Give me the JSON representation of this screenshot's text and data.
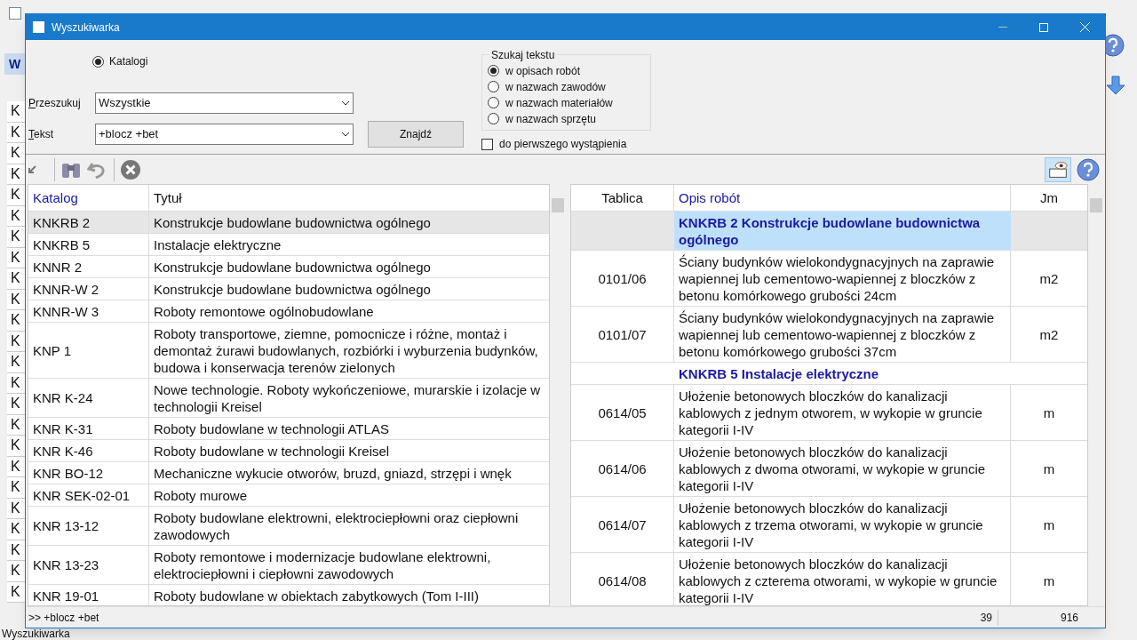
{
  "background": {
    "header": "W",
    "rows": [
      "K",
      "K",
      "K",
      "K",
      "K",
      "K",
      "K",
      "K",
      "K",
      "K",
      "K",
      "K",
      "K",
      "K",
      "K",
      "K",
      "K",
      "K",
      "K",
      "K",
      "K",
      "K",
      "K",
      "K"
    ],
    "status": "Wyszukiwarka"
  },
  "dialog": {
    "title": "Wyszukiwarka",
    "scope": {
      "label": "Katalogi",
      "selected": true
    },
    "search_in": {
      "label": "Przeszukuj",
      "value": "Wszystkie"
    },
    "text": {
      "label": "Tekst",
      "value": "+blocz +bet"
    },
    "find_button": "Znajdź",
    "search_text": {
      "title": "Szukaj tekstu",
      "options": [
        {
          "label": "w opisach robót",
          "selected": true
        },
        {
          "label": "w nazwach zawodów",
          "selected": false
        },
        {
          "label": "w nazwach materiałów",
          "selected": false
        },
        {
          "label": "w nazwach sprzętu",
          "selected": false
        }
      ]
    },
    "first_occurrence": {
      "label": "do pierwszego wystąpienia",
      "checked": false
    },
    "catalogs": {
      "columns": [
        "Katalog",
        "Tytuł"
      ],
      "rows": [
        {
          "catalog": "KNKRB 2",
          "title": "Konstrukcje budowlane budownictwa ogólnego",
          "selected": true
        },
        {
          "catalog": "KNKRB 5",
          "title": "Instalacje elektryczne",
          "selected": false
        },
        {
          "catalog": "KNNR 2",
          "title": "Konstrukcje budowlane budownictwa ogólnego",
          "selected": false
        },
        {
          "catalog": "KNNR-W 2",
          "title": "Konstrukcje budowlane budownictwa ogólnego",
          "selected": false
        },
        {
          "catalog": "KNNR-W 3",
          "title": "Roboty remontowe ogólnobudowlane",
          "selected": false
        },
        {
          "catalog": "KNP 1",
          "title": "Roboty transportowe, ziemne, pomocnicze i różne, montaż i demontaż żurawi budowlanych, rozbiórki i wyburzenia budynków, budowa i konserwacja terenów zielonych",
          "selected": false
        },
        {
          "catalog": "KNR K-24",
          "title": "Nowe technologie. Roboty wykończeniowe, murarskie i izolacje w technologii Kreisel",
          "selected": false
        },
        {
          "catalog": "KNR K-31",
          "title": "Roboty budowlane w technologii ATLAS",
          "selected": false
        },
        {
          "catalog": "KNR K-46",
          "title": "Roboty budowlane w technologii Kreisel",
          "selected": false
        },
        {
          "catalog": "KNR BO-12",
          "title": "Mechaniczne wykucie otworów, bruzd, gniazd, strzępi i wnęk",
          "selected": false
        },
        {
          "catalog": "KNR SEK-02-01",
          "title": "Roboty murowe",
          "selected": false
        },
        {
          "catalog": "KNR 13-12",
          "title": "Roboty budowlane elektrowni, elektrociepłowni oraz ciepłowni zawodowych",
          "selected": false
        },
        {
          "catalog": "KNR 13-23",
          "title": "Roboty remontowe i modernizacje budowlane elektrowni, elektrociepłowni i ciepłowni zawodowych",
          "selected": false
        },
        {
          "catalog": "KNR 19-01",
          "title": "Roboty budowlane w obiektach zabytkowych (Tom I-III)",
          "selected": false
        }
      ]
    },
    "results": {
      "columns": [
        "Tablica",
        "Opis robót",
        "Jm"
      ],
      "rows": [
        {
          "kind": "group",
          "description": "KNKRB 2 Konstrukcje budowlane budownictwa ogólnego",
          "selected": true
        },
        {
          "kind": "item",
          "table": "0101/06",
          "description": "Ściany budynków wielokondygnacyjnych na zaprawie wapiennej lub cementowo-wapiennej z bloczków z betonu komórkowego grubości 24cm",
          "unit": "m2"
        },
        {
          "kind": "item",
          "table": "0101/07",
          "description": "Ściany budynków wielokondygnacyjnych na zaprawie wapiennej lub cementowo-wapiennej z bloczków z betonu komórkowego grubości 37cm",
          "unit": "m2"
        },
        {
          "kind": "group",
          "description": "KNKRB 5 Instalacje elektryczne",
          "selected": false
        },
        {
          "kind": "item",
          "table": "0614/05",
          "description": "Ułożenie betonowych bloczków do kanalizacji kablowych z jednym otworem, w wykopie w gruncie kategorii I-IV",
          "unit": "m"
        },
        {
          "kind": "item",
          "table": "0614/06",
          "description": "Ułożenie betonowych bloczków do kanalizacji kablowych z dwoma otworami, w wykopie w gruncie kategorii I-IV",
          "unit": "m"
        },
        {
          "kind": "item",
          "table": "0614/07",
          "description": "Ułożenie betonowych bloczków do kanalizacji kablowych z trzema otworami, w wykopie w gruncie kategorii I-IV",
          "unit": "m"
        },
        {
          "kind": "item",
          "table": "0614/08",
          "description": "Ułożenie betonowych bloczków do kanalizacji kablowych z czterema otworami, w wykopie w gruncie kategorii I-IV",
          "unit": "m"
        }
      ]
    },
    "status": {
      "query": ">> +blocz +bet",
      "found": "39",
      "total": "916"
    }
  }
}
